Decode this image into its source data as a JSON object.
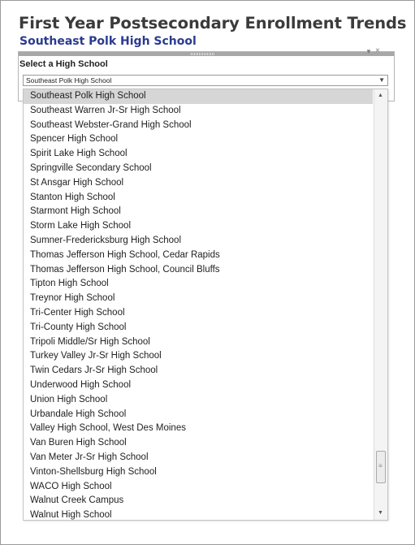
{
  "header": {
    "title": "First Year Postsecondary Enrollment Trends",
    "subtitle": "Southeast Polk High School"
  },
  "panel": {
    "label": "Select a High School",
    "selected_value": "Southeast Polk High School",
    "menu_icon": "dropdown-menu-icon",
    "close_icon": "close-icon"
  },
  "dropdown": {
    "selected_index": 0,
    "scroll_position": 0.93,
    "options": [
      "Southeast Polk High School",
      "Southeast Warren Jr-Sr High School",
      "Southeast Webster-Grand High School",
      "Spencer High School",
      "Spirit Lake High School",
      "Springville Secondary School",
      "St Ansgar High School",
      "Stanton High School",
      "Starmont High School",
      "Storm Lake High School",
      "Sumner-Fredericksburg High School",
      "Thomas Jefferson High School, Cedar Rapids",
      "Thomas Jefferson High School, Council Bluffs",
      "Tipton High School",
      "Treynor High School",
      "Tri-Center High School",
      "Tri-County High School",
      "Tripoli Middle/Sr High School",
      "Turkey Valley Jr-Sr High School",
      "Twin Cedars Jr-Sr High School",
      "Underwood High School",
      "Union High School",
      "Urbandale High School",
      "Valley High School, West Des Moines",
      "Van Buren High School",
      "Van Meter Jr-Sr High School",
      "Vinton-Shellsburg High School",
      "WACO High School",
      "Walnut Creek Campus",
      "Walnut High School"
    ]
  }
}
